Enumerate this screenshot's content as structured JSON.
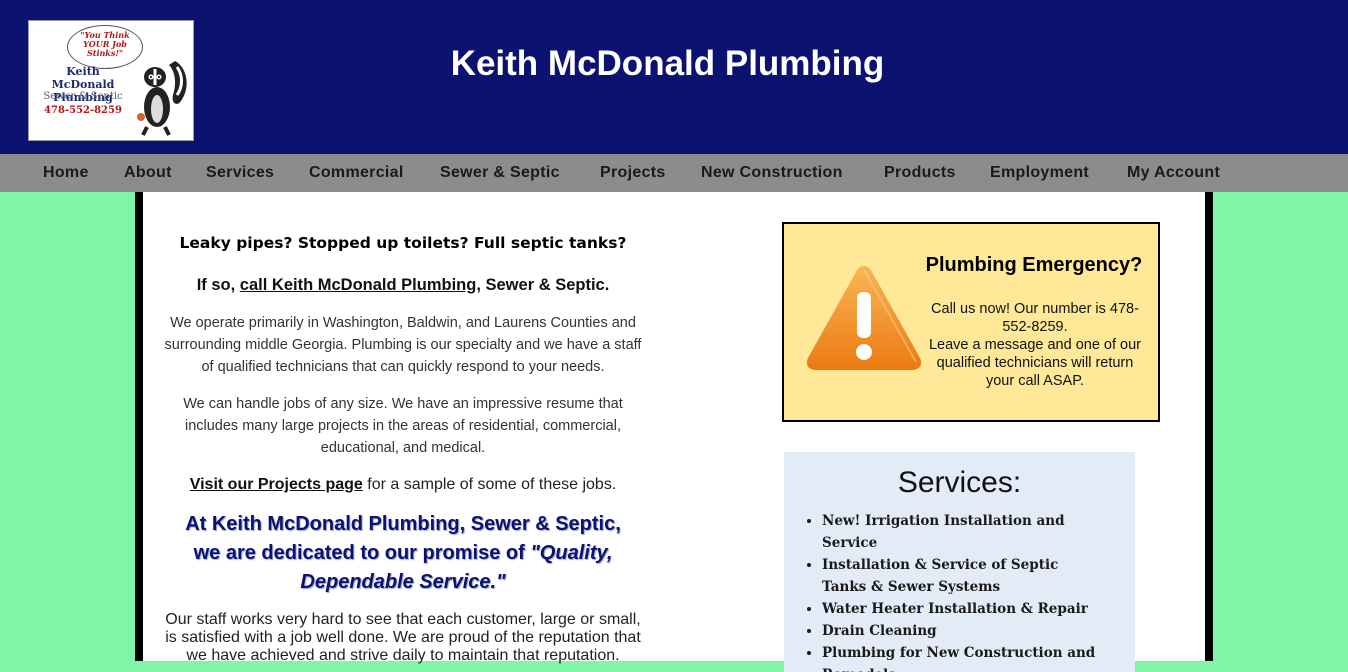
{
  "header": {
    "site_title": "Keith McDonald Plumbing",
    "logo": {
      "bubble": "\"You Think YOUR Job Stinks!\"",
      "name": "Keith McDonald Plumbing",
      "subtitle": "Sewer & Septic",
      "phone": "478-552-8259"
    }
  },
  "nav": {
    "items": [
      {
        "label": "Home"
      },
      {
        "label": "About"
      },
      {
        "label": "Services"
      },
      {
        "label": "Commercial"
      },
      {
        "label": "Sewer & Septic"
      },
      {
        "label": "Projects"
      },
      {
        "label": "New Construction"
      },
      {
        "label": "Products"
      },
      {
        "label": "Employment"
      },
      {
        "label": "My Account"
      }
    ]
  },
  "main": {
    "leaky": "Leaky pipes? Stopped up toilets? Full septic tanks?",
    "callus_pre": "If so, ",
    "callus_link": "call Keith McDonald Plumbing",
    "callus_post": ", Sewer & Septic.",
    "para1": "We operate primarily in Washington, Baldwin, and Laurens Counties and surrounding middle Georgia. Plumbing is our specialty and we have a staff of qualified technicians that can quickly respond to your needs.",
    "para2": "We can handle jobs of any size. We have an impressive resume that includes many large projects in the areas of residential, commercial, educational, and medical.",
    "visit_link": "Visit our Projects page",
    "visit_post": " for a sample of some of these jobs.",
    "dedicated_text": "At Keith McDonald Plumbing, Sewer & Septic, we are dedicated to our promise of ",
    "dedicated_quote": "\"Quality, Dependable Service.\"",
    "staff": "Our staff works very hard to see that each customer, large or small, is satisfied with a job well done. We are proud of the reputation that we have achieved and strive daily to maintain that reputation."
  },
  "emergency": {
    "title": "Plumbing Emergency?",
    "line1": "Call us now! Our number is 478-552-8259.",
    "line2": "Leave a message and one of our qualified technicians will return your call ASAP."
  },
  "services": {
    "title": "Services:",
    "items": [
      "New! Irrigation Installation and Service",
      "Installation & Service of Septic Tanks & Sewer Systems",
      "Water Heater Installation & Repair",
      "Drain Cleaning",
      "Plumbing for New Construction and Remodels"
    ]
  },
  "colors": {
    "header_bg": "#0b1270",
    "nav_bg": "#8c8c8c",
    "page_bg": "#7ff5a8",
    "emergency_bg": "#ffe998",
    "services_bg": "#e2ebf6",
    "warning_orange": "#f08a1c"
  }
}
